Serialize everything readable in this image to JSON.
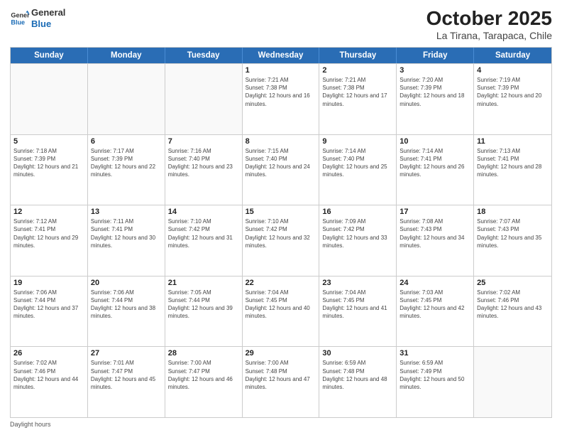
{
  "logo": {
    "line1": "General",
    "line2": "Blue"
  },
  "title": "October 2025",
  "subtitle": "La Tirana, Tarapaca, Chile",
  "weekdays": [
    "Sunday",
    "Monday",
    "Tuesday",
    "Wednesday",
    "Thursday",
    "Friday",
    "Saturday"
  ],
  "weeks": [
    [
      {
        "day": "",
        "sunrise": "",
        "sunset": "",
        "daylight": ""
      },
      {
        "day": "",
        "sunrise": "",
        "sunset": "",
        "daylight": ""
      },
      {
        "day": "",
        "sunrise": "",
        "sunset": "",
        "daylight": ""
      },
      {
        "day": "1",
        "sunrise": "Sunrise: 7:21 AM",
        "sunset": "Sunset: 7:38 PM",
        "daylight": "Daylight: 12 hours and 16 minutes."
      },
      {
        "day": "2",
        "sunrise": "Sunrise: 7:21 AM",
        "sunset": "Sunset: 7:38 PM",
        "daylight": "Daylight: 12 hours and 17 minutes."
      },
      {
        "day": "3",
        "sunrise": "Sunrise: 7:20 AM",
        "sunset": "Sunset: 7:39 PM",
        "daylight": "Daylight: 12 hours and 18 minutes."
      },
      {
        "day": "4",
        "sunrise": "Sunrise: 7:19 AM",
        "sunset": "Sunset: 7:39 PM",
        "daylight": "Daylight: 12 hours and 20 minutes."
      }
    ],
    [
      {
        "day": "5",
        "sunrise": "Sunrise: 7:18 AM",
        "sunset": "Sunset: 7:39 PM",
        "daylight": "Daylight: 12 hours and 21 minutes."
      },
      {
        "day": "6",
        "sunrise": "Sunrise: 7:17 AM",
        "sunset": "Sunset: 7:39 PM",
        "daylight": "Daylight: 12 hours and 22 minutes."
      },
      {
        "day": "7",
        "sunrise": "Sunrise: 7:16 AM",
        "sunset": "Sunset: 7:40 PM",
        "daylight": "Daylight: 12 hours and 23 minutes."
      },
      {
        "day": "8",
        "sunrise": "Sunrise: 7:15 AM",
        "sunset": "Sunset: 7:40 PM",
        "daylight": "Daylight: 12 hours and 24 minutes."
      },
      {
        "day": "9",
        "sunrise": "Sunrise: 7:14 AM",
        "sunset": "Sunset: 7:40 PM",
        "daylight": "Daylight: 12 hours and 25 minutes."
      },
      {
        "day": "10",
        "sunrise": "Sunrise: 7:14 AM",
        "sunset": "Sunset: 7:41 PM",
        "daylight": "Daylight: 12 hours and 26 minutes."
      },
      {
        "day": "11",
        "sunrise": "Sunrise: 7:13 AM",
        "sunset": "Sunset: 7:41 PM",
        "daylight": "Daylight: 12 hours and 28 minutes."
      }
    ],
    [
      {
        "day": "12",
        "sunrise": "Sunrise: 7:12 AM",
        "sunset": "Sunset: 7:41 PM",
        "daylight": "Daylight: 12 hours and 29 minutes."
      },
      {
        "day": "13",
        "sunrise": "Sunrise: 7:11 AM",
        "sunset": "Sunset: 7:41 PM",
        "daylight": "Daylight: 12 hours and 30 minutes."
      },
      {
        "day": "14",
        "sunrise": "Sunrise: 7:10 AM",
        "sunset": "Sunset: 7:42 PM",
        "daylight": "Daylight: 12 hours and 31 minutes."
      },
      {
        "day": "15",
        "sunrise": "Sunrise: 7:10 AM",
        "sunset": "Sunset: 7:42 PM",
        "daylight": "Daylight: 12 hours and 32 minutes."
      },
      {
        "day": "16",
        "sunrise": "Sunrise: 7:09 AM",
        "sunset": "Sunset: 7:42 PM",
        "daylight": "Daylight: 12 hours and 33 minutes."
      },
      {
        "day": "17",
        "sunrise": "Sunrise: 7:08 AM",
        "sunset": "Sunset: 7:43 PM",
        "daylight": "Daylight: 12 hours and 34 minutes."
      },
      {
        "day": "18",
        "sunrise": "Sunrise: 7:07 AM",
        "sunset": "Sunset: 7:43 PM",
        "daylight": "Daylight: 12 hours and 35 minutes."
      }
    ],
    [
      {
        "day": "19",
        "sunrise": "Sunrise: 7:06 AM",
        "sunset": "Sunset: 7:44 PM",
        "daylight": "Daylight: 12 hours and 37 minutes."
      },
      {
        "day": "20",
        "sunrise": "Sunrise: 7:06 AM",
        "sunset": "Sunset: 7:44 PM",
        "daylight": "Daylight: 12 hours and 38 minutes."
      },
      {
        "day": "21",
        "sunrise": "Sunrise: 7:05 AM",
        "sunset": "Sunset: 7:44 PM",
        "daylight": "Daylight: 12 hours and 39 minutes."
      },
      {
        "day": "22",
        "sunrise": "Sunrise: 7:04 AM",
        "sunset": "Sunset: 7:45 PM",
        "daylight": "Daylight: 12 hours and 40 minutes."
      },
      {
        "day": "23",
        "sunrise": "Sunrise: 7:04 AM",
        "sunset": "Sunset: 7:45 PM",
        "daylight": "Daylight: 12 hours and 41 minutes."
      },
      {
        "day": "24",
        "sunrise": "Sunrise: 7:03 AM",
        "sunset": "Sunset: 7:45 PM",
        "daylight": "Daylight: 12 hours and 42 minutes."
      },
      {
        "day": "25",
        "sunrise": "Sunrise: 7:02 AM",
        "sunset": "Sunset: 7:46 PM",
        "daylight": "Daylight: 12 hours and 43 minutes."
      }
    ],
    [
      {
        "day": "26",
        "sunrise": "Sunrise: 7:02 AM",
        "sunset": "Sunset: 7:46 PM",
        "daylight": "Daylight: 12 hours and 44 minutes."
      },
      {
        "day": "27",
        "sunrise": "Sunrise: 7:01 AM",
        "sunset": "Sunset: 7:47 PM",
        "daylight": "Daylight: 12 hours and 45 minutes."
      },
      {
        "day": "28",
        "sunrise": "Sunrise: 7:00 AM",
        "sunset": "Sunset: 7:47 PM",
        "daylight": "Daylight: 12 hours and 46 minutes."
      },
      {
        "day": "29",
        "sunrise": "Sunrise: 7:00 AM",
        "sunset": "Sunset: 7:48 PM",
        "daylight": "Daylight: 12 hours and 47 minutes."
      },
      {
        "day": "30",
        "sunrise": "Sunrise: 6:59 AM",
        "sunset": "Sunset: 7:48 PM",
        "daylight": "Daylight: 12 hours and 48 minutes."
      },
      {
        "day": "31",
        "sunrise": "Sunrise: 6:59 AM",
        "sunset": "Sunset: 7:49 PM",
        "daylight": "Daylight: 12 hours and 50 minutes."
      },
      {
        "day": "",
        "sunrise": "",
        "sunset": "",
        "daylight": ""
      }
    ]
  ],
  "footer": "Daylight hours"
}
